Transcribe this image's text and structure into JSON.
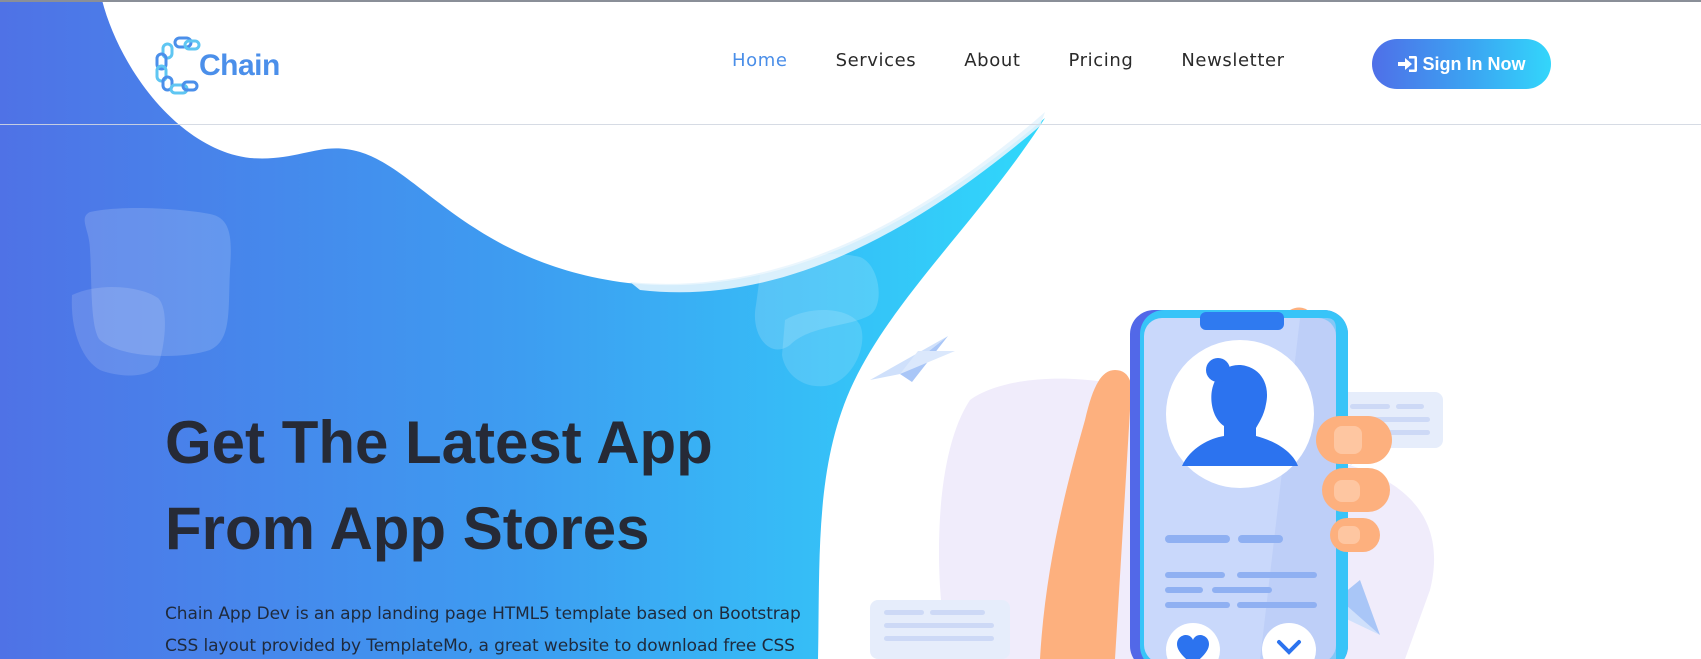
{
  "brand": {
    "name": "Chain"
  },
  "nav": {
    "items": [
      {
        "label": "Home",
        "active": true
      },
      {
        "label": "Services",
        "active": false
      },
      {
        "label": "About",
        "active": false
      },
      {
        "label": "Pricing",
        "active": false
      },
      {
        "label": "Newsletter",
        "active": false
      }
    ],
    "cta_label": "Sign In Now",
    "cta_icon": "sign-in-icon"
  },
  "hero": {
    "title_line1": "Get The Latest App",
    "title_line2": "From App Stores",
    "description": "Chain App Dev is an app landing page HTML5 template based on Bootstrap CSS layout provided by TemplateMo, a great website to download free CSS"
  },
  "colors": {
    "accent": "#4a8ee8",
    "gradient_start": "#4f6fe8",
    "gradient_end": "#33d6fb",
    "heading": "#262a36"
  },
  "illustration": {
    "icons": [
      "phone-icon",
      "profile-avatar-icon",
      "heart-icon",
      "close-icon",
      "paper-plane-icon",
      "chat-bubble-icon"
    ]
  }
}
